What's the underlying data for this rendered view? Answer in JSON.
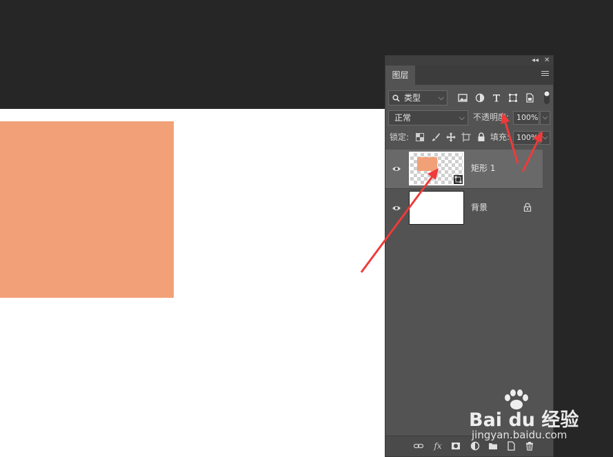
{
  "colors": {
    "workspace": "#262626",
    "panel": "#535353",
    "rectangle": "#f2a077",
    "arrow": "#f03a3a",
    "selected_row": "#696969"
  },
  "panel": {
    "title": "图层",
    "collapse_icon": "double-chevron-left-icon",
    "close_icon": "close-icon",
    "menu_icon": "hamburger-menu-icon"
  },
  "filter": {
    "type_label": "类型",
    "icons": [
      "image-filter-icon",
      "adjustment-filter-icon",
      "text-filter-icon",
      "shape-filter-icon",
      "smart-object-filter-icon"
    ]
  },
  "blend": {
    "mode": "正常",
    "opacity_label": "不透明度:",
    "opacity_value": "100%"
  },
  "lock": {
    "label": "锁定:",
    "fill_label": "填充:",
    "fill_value": "100%"
  },
  "layers": [
    {
      "name": "矩形 1",
      "visible": true,
      "selected": true
    },
    {
      "name": "背景",
      "visible": true,
      "selected": false,
      "locked": true
    }
  ],
  "bottom_bar": {
    "fx_label": "fx",
    "icons": [
      "link-icon",
      "fx-icon",
      "mask-icon",
      "adjustment-icon",
      "group-folder-icon",
      "new-layer-icon",
      "trash-icon"
    ]
  },
  "watermark": {
    "brand": "Bai du 经验",
    "url": "jingyan.baidu.com"
  }
}
